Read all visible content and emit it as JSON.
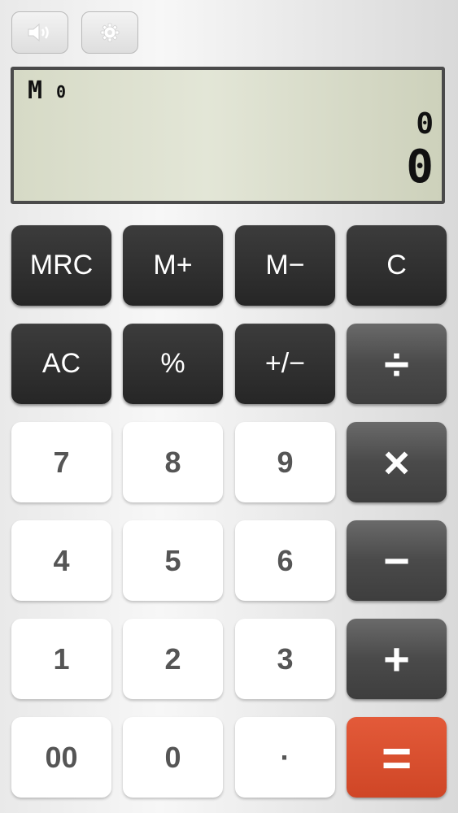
{
  "toolbar": {
    "sound_icon": "speaker-icon",
    "settings_icon": "gear-icon"
  },
  "display": {
    "memory_label": "M",
    "memory_value": "0",
    "secondary_value": "0",
    "main_value": "0"
  },
  "keys": {
    "mrc": "MRC",
    "m_plus": "M+",
    "m_minus": "M−",
    "clear": "C",
    "all_clear": "AC",
    "percent": "%",
    "plus_minus": "+/−",
    "divide": "÷",
    "seven": "7",
    "eight": "8",
    "nine": "9",
    "multiply": "×",
    "four": "4",
    "five": "5",
    "six": "6",
    "minus": "−",
    "one": "1",
    "two": "2",
    "three": "3",
    "plus": "+",
    "double_zero": "00",
    "zero": "0",
    "decimal": "·",
    "equals": "="
  },
  "colors": {
    "equals_key": "#d94d2d",
    "dark_key": "#2f2f2f",
    "display_bg": "#dde0cf"
  }
}
